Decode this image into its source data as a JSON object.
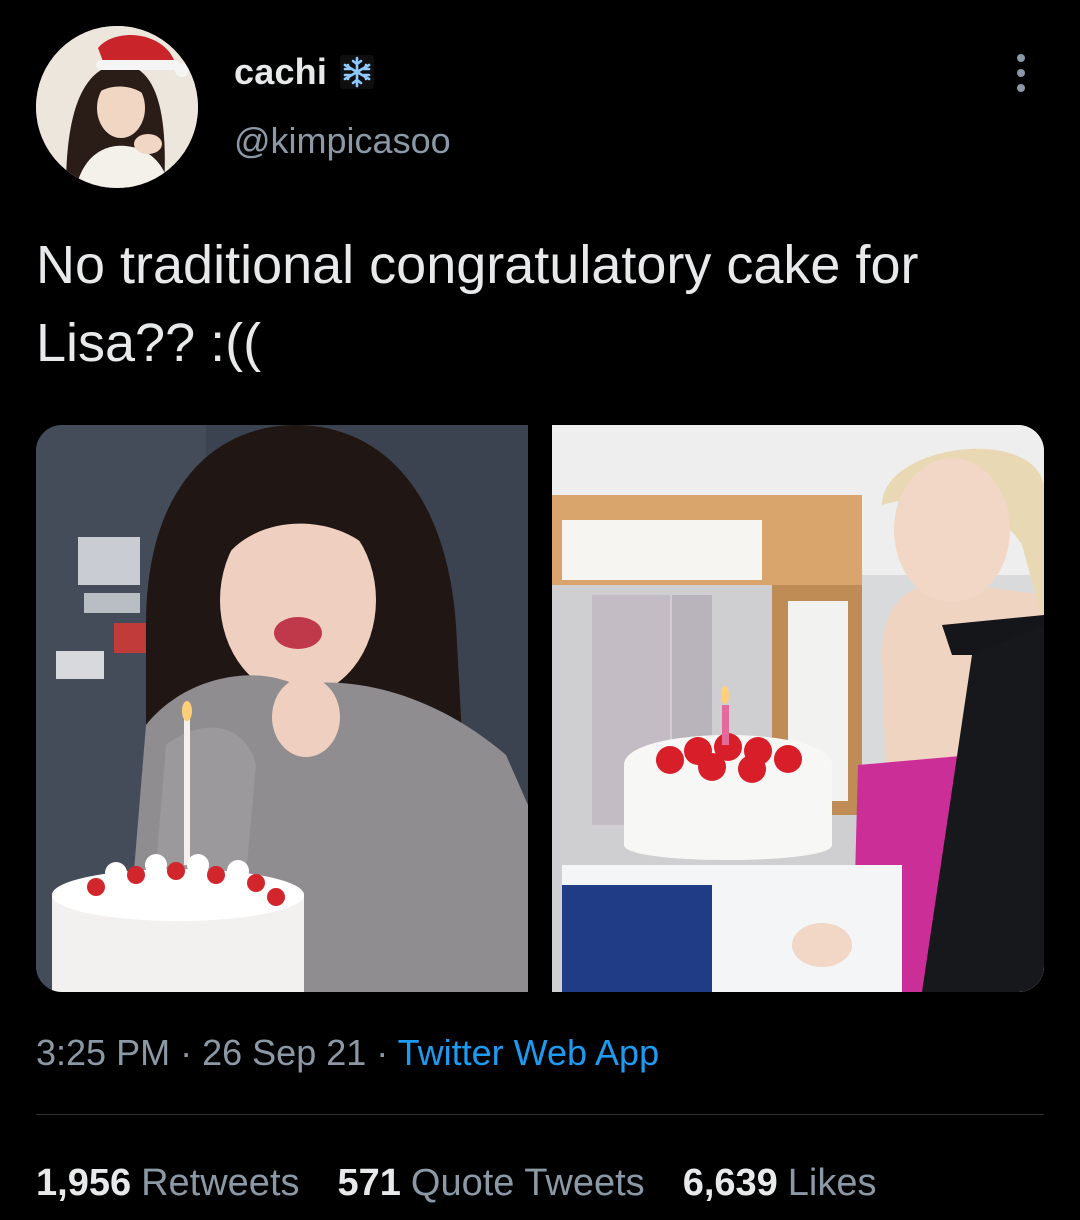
{
  "author": {
    "display_name": "cachi",
    "handle": "@kimpicasoo",
    "name_emoji": "snowflake-icon"
  },
  "tweet": {
    "text": "No traditional congratulatory cake for Lisa?? :((",
    "time": "3:25 PM",
    "date": "26 Sep 21",
    "separator": "·",
    "source": "Twitter Web App"
  },
  "stats": {
    "retweets_count": "1,956",
    "retweets_label": "Retweets",
    "quotes_count": "571",
    "quotes_label": "Quote Tweets",
    "likes_count": "6,639",
    "likes_label": "Likes"
  },
  "colors": {
    "background": "#000000",
    "primary_text": "#e7e9ea",
    "secondary_text": "#8b98a5",
    "link": "#1d9bf0",
    "divider": "#2f3336"
  }
}
